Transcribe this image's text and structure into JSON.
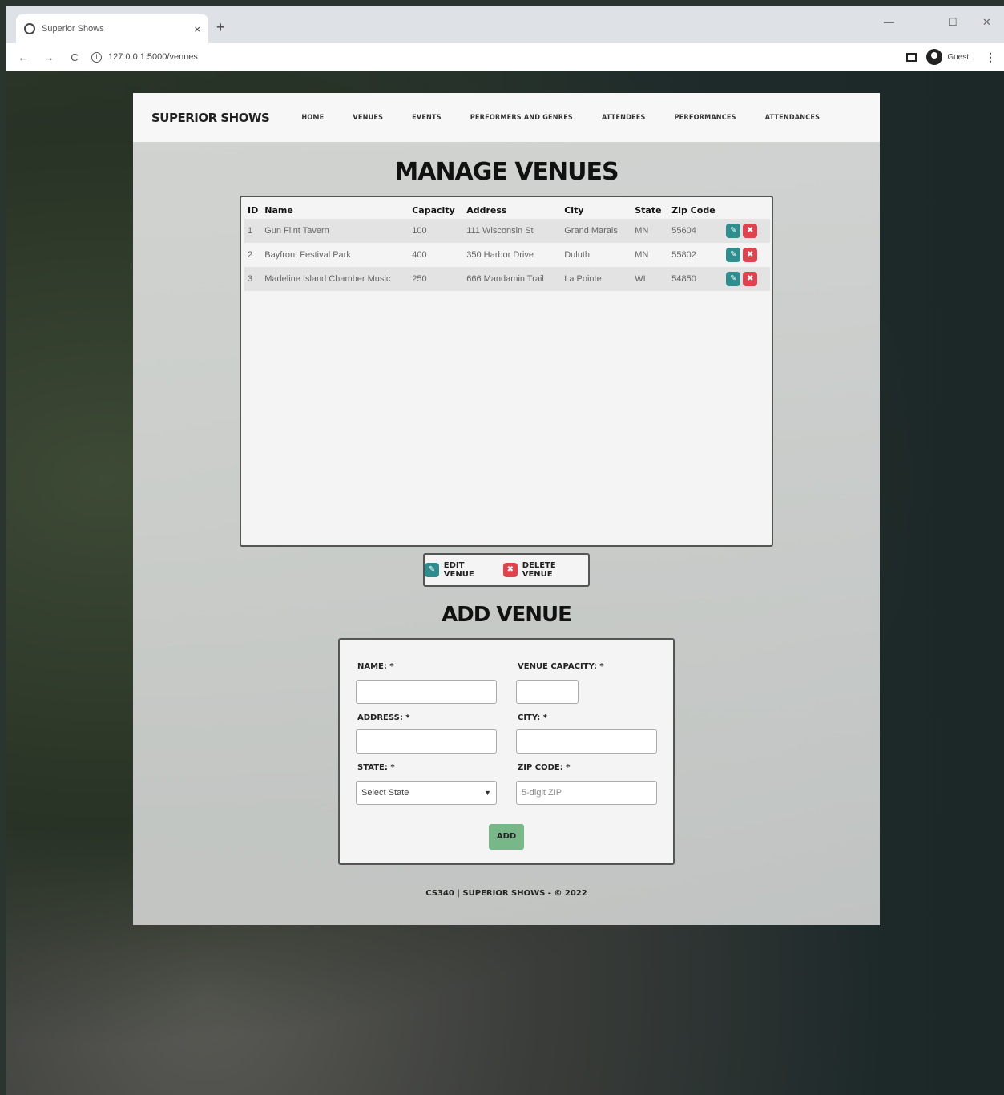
{
  "browser": {
    "tab_title": "Superior Shows",
    "tab_close": "×",
    "new_tab": "+",
    "back": "←",
    "forward": "→",
    "reload": "C",
    "info": "i",
    "url": "127.0.0.1:5000/venues",
    "profile_label": "Guest",
    "menu": "⋮",
    "minimize": "—",
    "maximize": "☐",
    "close": "✕"
  },
  "nav": {
    "brand": "SUPERIOR SHOWS",
    "links": [
      "HOME",
      "VENUES",
      "EVENTS",
      "PERFORMERS AND GENRES",
      "ATTENDEES",
      "PERFORMANCES",
      "ATTENDANCES"
    ]
  },
  "page_title": "MANAGE VENUES",
  "table": {
    "headers": [
      "ID",
      "Name",
      "Capacity",
      "Address",
      "City",
      "State",
      "Zip Code"
    ],
    "rows": [
      [
        "1",
        "Gun Flint Tavern",
        "100",
        "111 Wisconsin St",
        "Grand Marais",
        "MN",
        "55604"
      ],
      [
        "2",
        "Bayfront Festival Park",
        "400",
        "350 Harbor Drive",
        "Duluth",
        "MN",
        "55802"
      ],
      [
        "3",
        "Madeline Island Chamber Music",
        "250",
        "666 Mandamin Trail",
        "La Pointe",
        "WI",
        "54850"
      ]
    ]
  },
  "icons": {
    "edit": "✎",
    "delete": "✖"
  },
  "legend": {
    "edit_label": "EDIT VENUE",
    "delete_label": "DELETE VENUE"
  },
  "add_title": "ADD VENUE",
  "form": {
    "name_label": "NAME: *",
    "capacity_label": "VENUE CAPACITY: *",
    "address_label": "ADDRESS: *",
    "city_label": "CITY: *",
    "state_label": "STATE: *",
    "zip_label": "ZIP CODE: *",
    "state_selected": "Select State",
    "zip_placeholder": "5-digit ZIP",
    "add_button": "ADD"
  },
  "footer": "CS340 | SUPERIOR SHOWS - © 2022",
  "colors": {
    "edit": "#2f8d8d",
    "delete": "#e0434e",
    "add_button": "#78b888"
  }
}
